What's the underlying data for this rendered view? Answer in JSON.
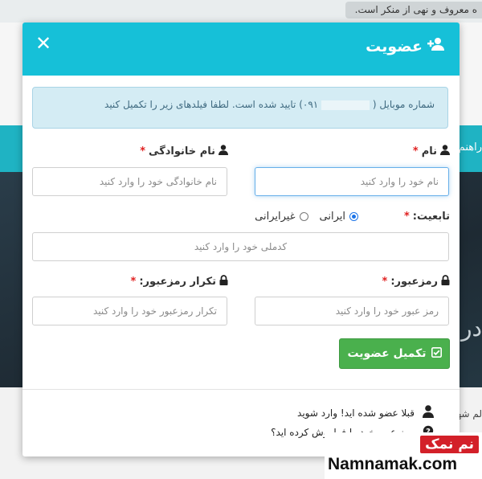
{
  "background": {
    "notice": "ه معروف و نهی از منکر است.",
    "teal_text": "راهنم",
    "dark_text": "دروبـ",
    "light_text": "لم شهر"
  },
  "modal": {
    "title": "عضویت",
    "title_icon": "user-plus-icon",
    "close_icon": "close-icon",
    "alert": {
      "prefix": "شماره موبایل (",
      "phone": "۰۹۱",
      "suffix": ") تایید شده است. لطفا فیلدهای زیر را تکمیل کنید"
    },
    "fields": {
      "first_name": {
        "label": "نام",
        "placeholder": "نام خود را وارد کنید",
        "required": "*"
      },
      "last_name": {
        "label": "نام خانوادگی",
        "placeholder": "نام خانوادگی خود را وارد کنید",
        "required": "*"
      },
      "nationality": {
        "label": "تابعیت:",
        "required": "*",
        "options": [
          "ایرانی",
          "غیرایرانی"
        ],
        "selected": "ایرانی",
        "placeholder": "کدملی خود را وارد کنید"
      },
      "password": {
        "label": "رمزعبور:",
        "placeholder": "رمز عبور خود را وارد کنید",
        "required": "*"
      },
      "password_repeat": {
        "label": "تکرار رمزعبور:",
        "placeholder": "تکرار رمزعبور خود را وارد کنید",
        "required": "*"
      }
    },
    "submit_label": "تکمیل عضویت",
    "submit_icon": "check-square-icon",
    "footer": {
      "login_text": "قبلا عضو شده اید! وارد شوید",
      "login_icon": "user-icon",
      "forgot_text": "رمز عبور خود را فراموش کرده اید؟",
      "forgot_icon": "question-icon"
    }
  },
  "watermark": {
    "badge": "نم نمک",
    "site": "Namnamak.com"
  },
  "colors": {
    "header": "#16c0d8",
    "submit": "#4ab04d",
    "required": "#e02020",
    "alert_bg": "#d4ecf4"
  }
}
